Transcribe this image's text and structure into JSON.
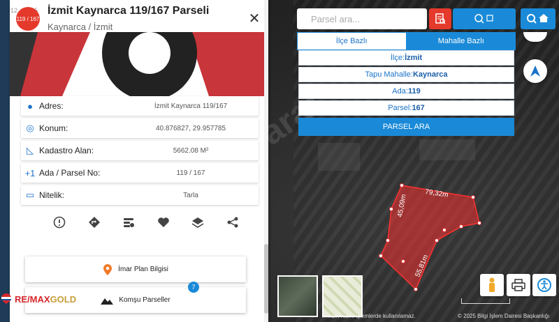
{
  "panel": {
    "badge": "119 / 167",
    "faint_id": "#12…1445",
    "title": "İzmit Kaynarca 119/167 Parseli",
    "subtitle": "Kaynarca / İzmit",
    "close_icon": "close-icon",
    "rows": [
      {
        "icon": "pin-icon",
        "label": "Adres:",
        "value": "İzmit Kaynarca 119/167"
      },
      {
        "icon": "target-icon",
        "label": "Konum:",
        "value": "40.876827, 29.957785"
      },
      {
        "icon": "ruler-icon",
        "label": "Kadastro Alan:",
        "value": "5662.08 M²"
      },
      {
        "icon": "plus-one-icon",
        "label": "Ada / Parsel No:",
        "value": "119 / 167"
      },
      {
        "icon": "tag-icon",
        "label": "Nitelik:",
        "value": "Tarla"
      }
    ],
    "row_icons_text": [
      "●",
      "◎",
      "◺",
      "+1",
      "▭"
    ],
    "actions": [
      "alert-icon",
      "directions-icon",
      "info-list-icon",
      "heart-icon",
      "layers-icon",
      "share-icon"
    ],
    "imar_label": "İmar Plan Bilgisi",
    "komsu_label": "Komşu Parseller",
    "komsu_count": "7",
    "brand_re": "RE/MAX",
    "brand_gold": " GOLD"
  },
  "search": {
    "placeholder": "Parsel ara...",
    "tabs": [
      {
        "label": "İlçe Bazlı",
        "active": false
      },
      {
        "label": "Mahalle Bazlı",
        "active": true
      }
    ],
    "fields": [
      {
        "label": "İlçe:",
        "value": "İzmit"
      },
      {
        "label": "Tapu Mahalle:",
        "value": "Kaynarca"
      },
      {
        "label": "Ada:",
        "value": "119"
      },
      {
        "label": "Parsel:",
        "value": "167"
      }
    ],
    "submit_label": "PARSEL ARA"
  },
  "map": {
    "dimensions": [
      "79,32m",
      "45,09m",
      "55,81m"
    ],
    "footer": "…ılıdır, resmi işlemlerde kullanılamaz.",
    "credit": "© 2025 Bilgi İşlem Dairesi Başkanlığı",
    "parcel_color": "#e53030",
    "accent": "#1a8ad8",
    "red_accent": "#e5392c"
  }
}
